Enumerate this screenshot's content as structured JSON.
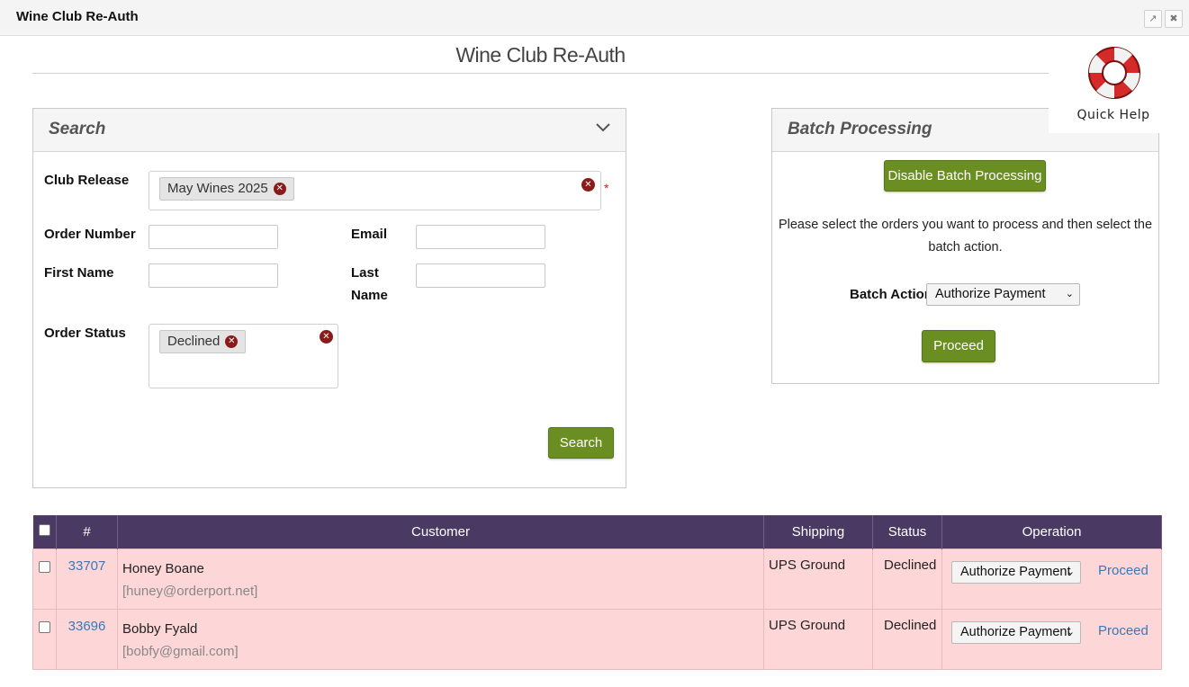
{
  "window": {
    "title": "Wine Club Re-Auth"
  },
  "page": {
    "title": "Wine Club Re-Auth"
  },
  "quick_help": {
    "label": "Quick Help"
  },
  "search": {
    "title": "Search",
    "club_release_label": "Club Release",
    "club_release_tag": "May Wines 2025",
    "required_mark": "*",
    "order_number_label": "Order Number",
    "order_number_value": "",
    "email_label": "Email",
    "email_value": "",
    "first_name_label": "First Name",
    "first_name_value": "",
    "last_name_label_1": "Last",
    "last_name_label_2": "Name",
    "last_name_value": "",
    "order_status_label": "Order Status",
    "order_status_tag": "Declined",
    "search_button": "Search"
  },
  "batch": {
    "title": "Batch Processing",
    "disable_button": "Disable Batch Processing",
    "instructions": "Please select the orders you want to process and then select the batch action.",
    "action_label": "Batch Action",
    "action_value": "Authorize Payment",
    "proceed_button": "Proceed"
  },
  "table": {
    "headers": [
      "#",
      "Customer",
      "Shipping",
      "Status",
      "Operation"
    ],
    "rows": [
      {
        "id": "33707",
        "name": "Honey Boane",
        "email": "[huney@orderport.net]",
        "shipping": "UPS Ground",
        "status": "Declined",
        "operation": "Authorize Payment",
        "proceed": "Proceed"
      },
      {
        "id": "33696",
        "name": "Bobby Fyald",
        "email": "[bobfy@gmail.com]",
        "shipping": "UPS Ground",
        "status": "Declined",
        "operation": "Authorize Payment",
        "proceed": "Proceed"
      }
    ]
  },
  "colors": {
    "accent_green": "#6b8e23",
    "header_purple": "#4a3a63",
    "row_pink": "#fdd6d8",
    "remove_red": "#8b1b1b",
    "link_blue": "#3a78b8"
  }
}
